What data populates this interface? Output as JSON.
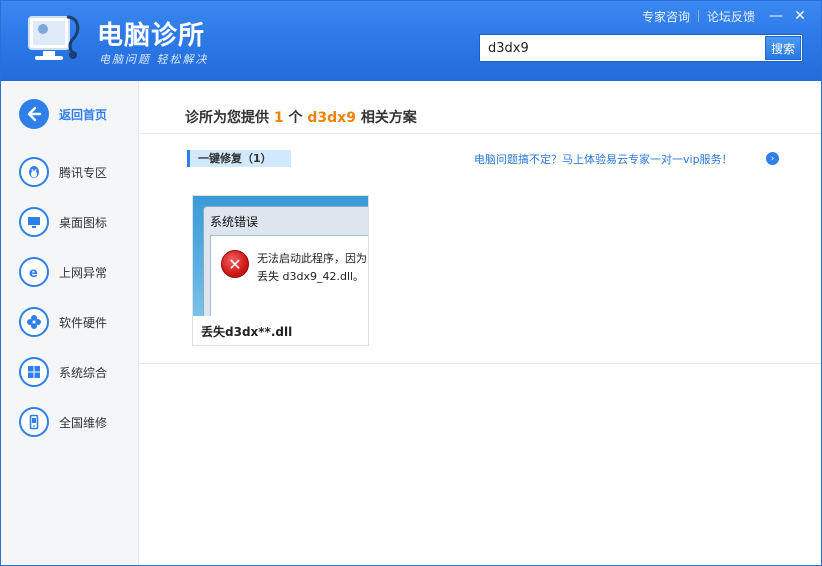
{
  "app": {
    "title": "电脑诊所",
    "slogan": "电脑问题 轻松解决"
  },
  "top_bar": {
    "expert_consult": "专家咨询",
    "forum_feedback": "论坛反馈",
    "minimize": "—",
    "close": "✕"
  },
  "search": {
    "value": "d3dx9",
    "button_label": "搜索"
  },
  "sidebar": {
    "back_label": "返回首页",
    "items": [
      {
        "label": "腾讯专区",
        "icon": "penguin-icon"
      },
      {
        "label": "桌面图标",
        "icon": "monitor-icon"
      },
      {
        "label": "上网异常",
        "icon": "ie-icon"
      },
      {
        "label": "软件硬件",
        "icon": "gear-icon"
      },
      {
        "label": "系统综合",
        "icon": "windows-icon"
      },
      {
        "label": "全国维修",
        "icon": "phone-icon"
      }
    ]
  },
  "main": {
    "title_prefix": "诊所为您提供",
    "result_count": "1",
    "title_mid": "个",
    "keyword": "d3dx9",
    "title_suffix": "相关方案",
    "section_label": "一键修复（1）",
    "promo_text": "电脑问题搞不定？马上体验易云专家一对一vip服务！",
    "promo_arrow": "›",
    "card": {
      "dialog_title": "系统错误",
      "error_symbol": "✕",
      "message_line1": "无法启动此程序，因为",
      "message_line2": "丢失 d3dx9_42.dll。",
      "label": "丢失d3dx**.dll"
    }
  },
  "colors": {
    "header_blue": "#2b77e6",
    "accent_blue": "#2f7fe8",
    "highlight_orange": "#f0840a",
    "section_bg": "#d2e9fb"
  }
}
